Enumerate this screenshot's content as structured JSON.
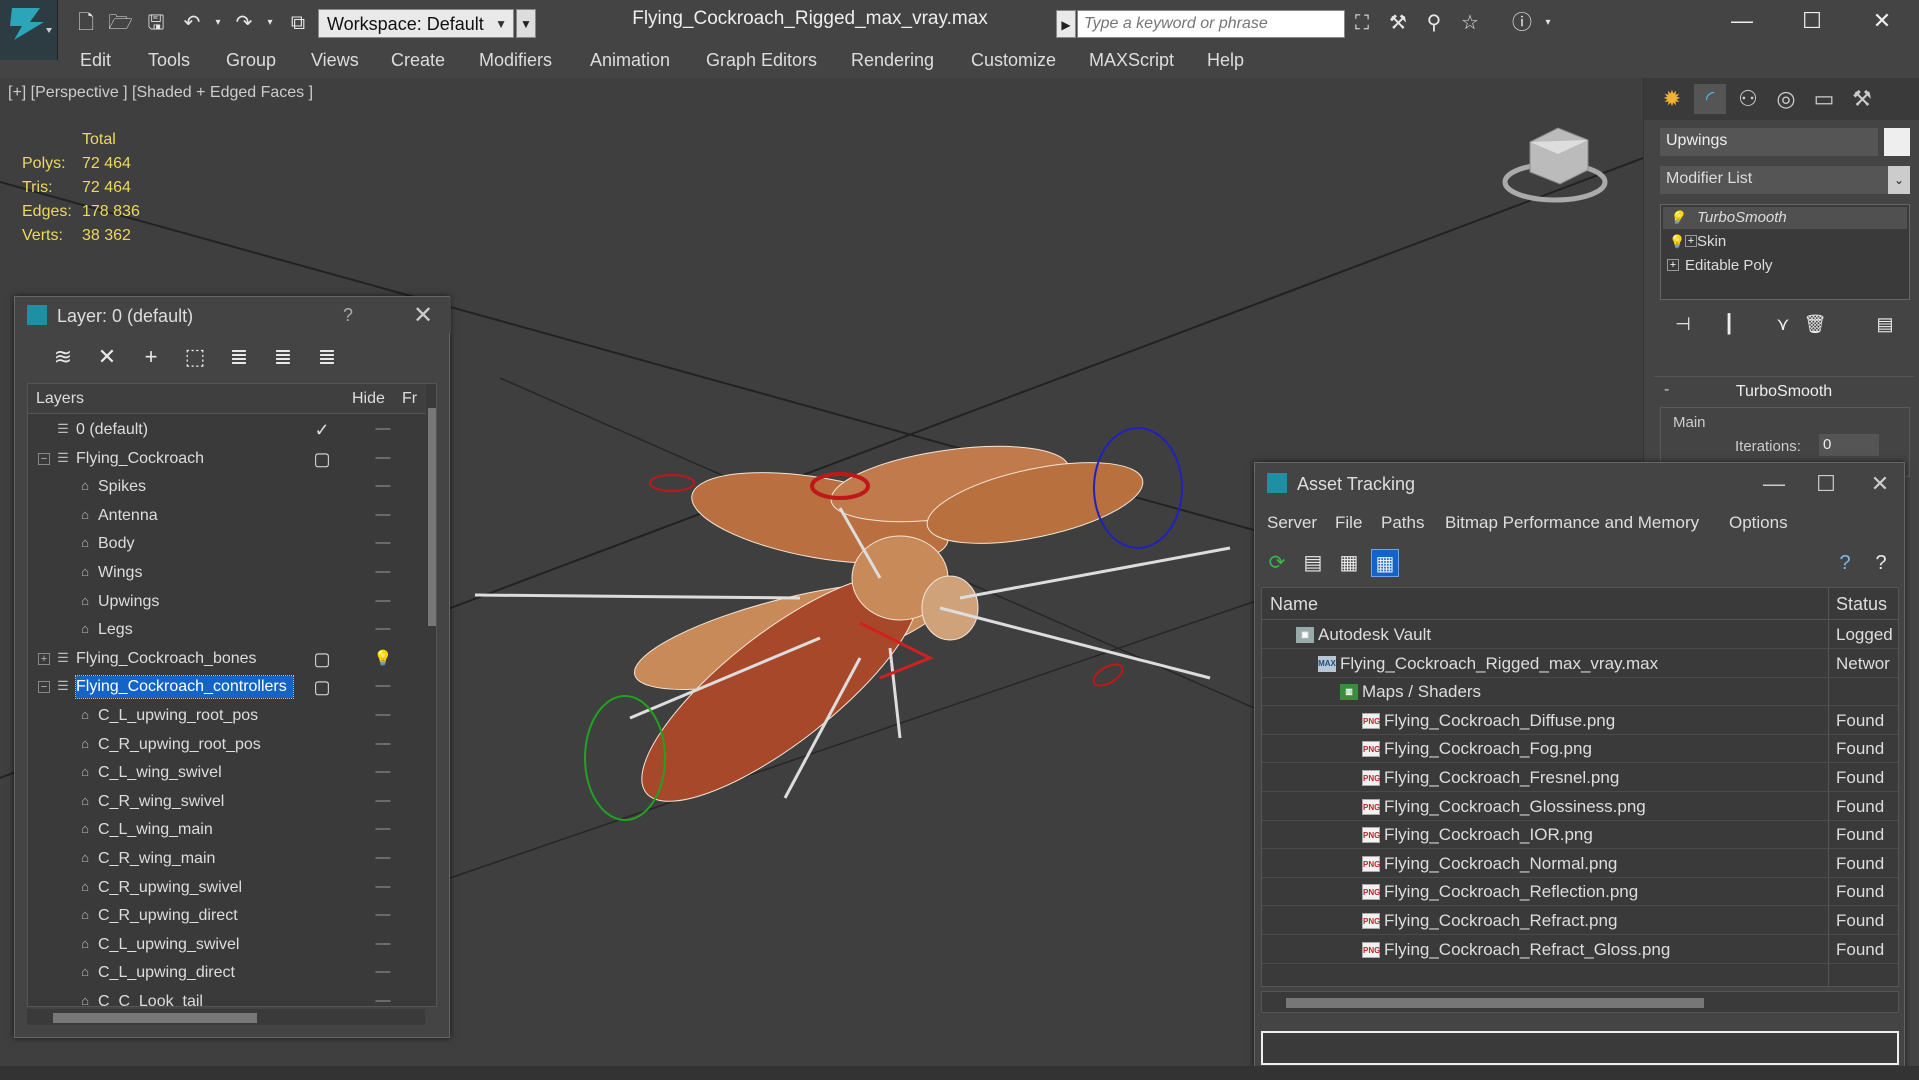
{
  "titlebar": {
    "workspace": "Workspace: Default",
    "file_title": "Flying_Cockroach_Rigged_max_vray.max",
    "search_placeholder": "Type a keyword or phrase"
  },
  "menubar": {
    "items": [
      "Edit",
      "Tools",
      "Group",
      "Views",
      "Create",
      "Modifiers",
      "Animation",
      "Graph Editors",
      "Rendering",
      "Customize",
      "MAXScript",
      "Help"
    ]
  },
  "viewport": {
    "label": "[+] [Perspective ] [Shaded + Edged Faces ]",
    "stats": {
      "header": "Total",
      "rows": [
        {
          "label": "Polys:",
          "value": "72 464"
        },
        {
          "label": "Tris:",
          "value": "72 464"
        },
        {
          "label": "Edges:",
          "value": "178 836"
        },
        {
          "label": "Verts:",
          "value": "38 362"
        }
      ]
    }
  },
  "command_panel": {
    "object_name": "Upwings",
    "modifier_list": "Modifier List",
    "stack": [
      "TurboSmooth",
      "Skin",
      "Editable Poly"
    ],
    "rollout_title": "TurboSmooth",
    "group_label": "Main",
    "iterations_label": "Iterations:",
    "iterations_value": "0"
  },
  "layer_window": {
    "title": "Layer: 0 (default)",
    "help": "?",
    "columns": {
      "layers": "Layers",
      "hide": "Hide",
      "freeze": "Fr"
    },
    "rows": [
      {
        "name": "0 (default)",
        "level": 0,
        "type": "layer",
        "current": true
      },
      {
        "name": "Flying_Cockroach",
        "level": 0,
        "type": "layer",
        "expand": "−"
      },
      {
        "name": "Spikes",
        "level": 1,
        "type": "object"
      },
      {
        "name": "Antenna",
        "level": 1,
        "type": "object"
      },
      {
        "name": "Body",
        "level": 1,
        "type": "object"
      },
      {
        "name": "Wings",
        "level": 1,
        "type": "object"
      },
      {
        "name": "Upwings",
        "level": 1,
        "type": "object"
      },
      {
        "name": "Legs",
        "level": 1,
        "type": "object"
      },
      {
        "name": "Flying_Cockroach_bones",
        "level": 0,
        "type": "layer",
        "expand": "+",
        "hidden": true
      },
      {
        "name": "Flying_Cockroach_controllers",
        "level": 0,
        "type": "layer",
        "expand": "−",
        "selected": true
      },
      {
        "name": "C_L_upwing_root_pos",
        "level": 1,
        "type": "object"
      },
      {
        "name": "C_R_upwing_root_pos",
        "level": 1,
        "type": "object"
      },
      {
        "name": "C_L_wing_swivel",
        "level": 1,
        "type": "object"
      },
      {
        "name": "C_R_wing_swivel",
        "level": 1,
        "type": "object"
      },
      {
        "name": "C_L_wing_main",
        "level": 1,
        "type": "object"
      },
      {
        "name": "C_R_wing_main",
        "level": 1,
        "type": "object"
      },
      {
        "name": "C_R_upwing_swivel",
        "level": 1,
        "type": "object"
      },
      {
        "name": "C_R_upwing_direct",
        "level": 1,
        "type": "object"
      },
      {
        "name": "C_L_upwing_swivel",
        "level": 1,
        "type": "object"
      },
      {
        "name": "C_L_upwing_direct",
        "level": 1,
        "type": "object"
      },
      {
        "name": "C_C_Look_tail",
        "level": 1,
        "type": "object"
      }
    ]
  },
  "asset_window": {
    "title": "Asset Tracking",
    "menu": [
      "Server",
      "File",
      "Paths",
      "Bitmap Performance and Memory",
      "Options"
    ],
    "columns": {
      "name": "Name",
      "status": "Status"
    },
    "rows": [
      {
        "name": "Autodesk Vault",
        "indent": 1,
        "icon": "vault",
        "status": "Logged"
      },
      {
        "name": "Flying_Cockroach_Rigged_max_vray.max",
        "indent": 2,
        "icon": "max",
        "status": "Networ"
      },
      {
        "name": "Maps / Shaders",
        "indent": 3,
        "icon": "maps",
        "status": ""
      },
      {
        "name": "Flying_Cockroach_Diffuse.png",
        "indent": 4,
        "icon": "png",
        "status": "Found"
      },
      {
        "name": "Flying_Cockroach_Fog.png",
        "indent": 4,
        "icon": "png",
        "status": "Found"
      },
      {
        "name": "Flying_Cockroach_Fresnel.png",
        "indent": 4,
        "icon": "png",
        "status": "Found"
      },
      {
        "name": "Flying_Cockroach_Glossiness.png",
        "indent": 4,
        "icon": "png",
        "status": "Found"
      },
      {
        "name": "Flying_Cockroach_IOR.png",
        "indent": 4,
        "icon": "png",
        "status": "Found"
      },
      {
        "name": "Flying_Cockroach_Normal.png",
        "indent": 4,
        "icon": "png",
        "status": "Found"
      },
      {
        "name": "Flying_Cockroach_Reflection.png",
        "indent": 4,
        "icon": "png",
        "status": "Found"
      },
      {
        "name": "Flying_Cockroach_Refract.png",
        "indent": 4,
        "icon": "png",
        "status": "Found"
      },
      {
        "name": "Flying_Cockroach_Refract_Gloss.png",
        "indent": 4,
        "icon": "png",
        "status": "Found"
      }
    ]
  },
  "colors": {
    "selection": "#1464c8",
    "stats_text": "#eed95c",
    "app_accent": "#1f8fa3"
  }
}
